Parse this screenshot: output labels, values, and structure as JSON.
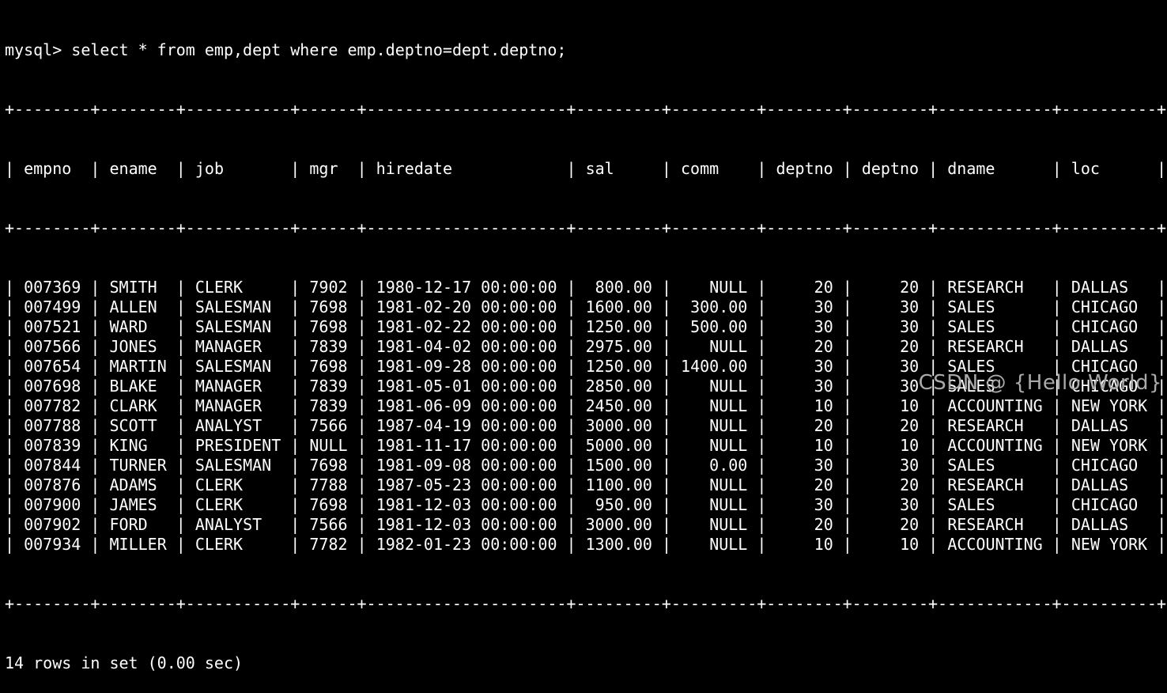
{
  "terminal": {
    "prompt": "mysql> ",
    "command": "select * from emp,dept where emp.deptno=dept.deptno;",
    "columns": [
      "empno",
      "ename",
      "job",
      "mgr",
      "hiredate",
      "sal",
      "comm",
      "deptno",
      "deptno",
      "dname",
      "loc"
    ],
    "rows": [
      [
        "007369",
        "SMITH",
        "CLERK",
        "7902",
        "1980-12-17 00:00:00",
        "800.00",
        "NULL",
        "20",
        "20",
        "RESEARCH",
        "DALLAS"
      ],
      [
        "007499",
        "ALLEN",
        "SALESMAN",
        "7698",
        "1981-02-20 00:00:00",
        "1600.00",
        "300.00",
        "30",
        "30",
        "SALES",
        "CHICAGO"
      ],
      [
        "007521",
        "WARD",
        "SALESMAN",
        "7698",
        "1981-02-22 00:00:00",
        "1250.00",
        "500.00",
        "30",
        "30",
        "SALES",
        "CHICAGO"
      ],
      [
        "007566",
        "JONES",
        "MANAGER",
        "7839",
        "1981-04-02 00:00:00",
        "2975.00",
        "NULL",
        "20",
        "20",
        "RESEARCH",
        "DALLAS"
      ],
      [
        "007654",
        "MARTIN",
        "SALESMAN",
        "7698",
        "1981-09-28 00:00:00",
        "1250.00",
        "1400.00",
        "30",
        "30",
        "SALES",
        "CHICAGO"
      ],
      [
        "007698",
        "BLAKE",
        "MANAGER",
        "7839",
        "1981-05-01 00:00:00",
        "2850.00",
        "NULL",
        "30",
        "30",
        "SALES",
        "CHICAGO"
      ],
      [
        "007782",
        "CLARK",
        "MANAGER",
        "7839",
        "1981-06-09 00:00:00",
        "2450.00",
        "NULL",
        "10",
        "10",
        "ACCOUNTING",
        "NEW YORK"
      ],
      [
        "007788",
        "SCOTT",
        "ANALYST",
        "7566",
        "1987-04-19 00:00:00",
        "3000.00",
        "NULL",
        "20",
        "20",
        "RESEARCH",
        "DALLAS"
      ],
      [
        "007839",
        "KING",
        "PRESIDENT",
        "NULL",
        "1981-11-17 00:00:00",
        "5000.00",
        "NULL",
        "10",
        "10",
        "ACCOUNTING",
        "NEW YORK"
      ],
      [
        "007844",
        "TURNER",
        "SALESMAN",
        "7698",
        "1981-09-08 00:00:00",
        "1500.00",
        "0.00",
        "30",
        "30",
        "SALES",
        "CHICAGO"
      ],
      [
        "007876",
        "ADAMS",
        "CLERK",
        "7788",
        "1987-05-23 00:00:00",
        "1100.00",
        "NULL",
        "20",
        "20",
        "RESEARCH",
        "DALLAS"
      ],
      [
        "007900",
        "JAMES",
        "CLERK",
        "7698",
        "1981-12-03 00:00:00",
        "950.00",
        "NULL",
        "30",
        "30",
        "SALES",
        "CHICAGO"
      ],
      [
        "007902",
        "FORD",
        "ANALYST",
        "7566",
        "1981-12-03 00:00:00",
        "3000.00",
        "NULL",
        "20",
        "20",
        "RESEARCH",
        "DALLAS"
      ],
      [
        "007934",
        "MILLER",
        "CLERK",
        "7782",
        "1982-01-23 00:00:00",
        "1300.00",
        "NULL",
        "10",
        "10",
        "ACCOUNTING",
        "NEW YORK"
      ]
    ],
    "status": "14 rows in set (0.00 sec)"
  },
  "watermark": "CSDN @ {Hello World}",
  "colors": {
    "background": "#000000",
    "text": "#ffffff",
    "watermark": "#a9a9a9"
  }
}
